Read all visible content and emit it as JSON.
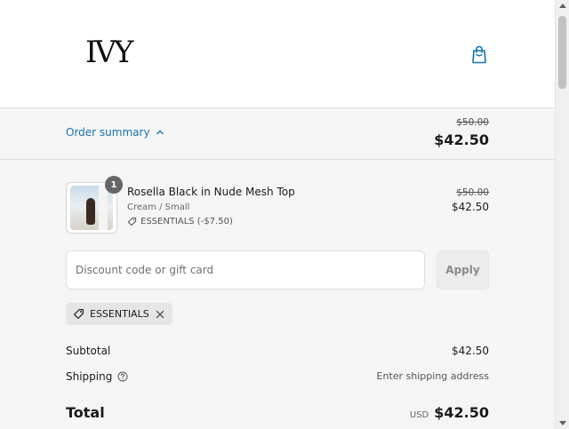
{
  "store": {
    "logo_text": "IVY"
  },
  "header": {
    "cart_icon": "shopping-bag-icon"
  },
  "summary": {
    "toggle_label": "Order summary",
    "compare_price": "$50.00",
    "total": "$42.50"
  },
  "item": {
    "quantity": "1",
    "name": "Rosella Black in Nude Mesh Top",
    "variant": "Cream / Small",
    "discount": "ESSENTIALS (-$7.50)",
    "compare_price": "$50.00",
    "price": "$42.50"
  },
  "discount_form": {
    "placeholder": "Discount code or gift card",
    "value": "",
    "apply_label": "Apply"
  },
  "applied_code": {
    "code": "ESSENTIALS"
  },
  "totals": {
    "subtotal_label": "Subtotal",
    "subtotal_value": "$42.50",
    "shipping_label": "Shipping",
    "shipping_value": "Enter shipping address",
    "total_label": "Total",
    "currency": "USD",
    "total_value": "$42.50"
  },
  "colors": {
    "accent": "#1773b0",
    "background": "#f5f5f5"
  }
}
